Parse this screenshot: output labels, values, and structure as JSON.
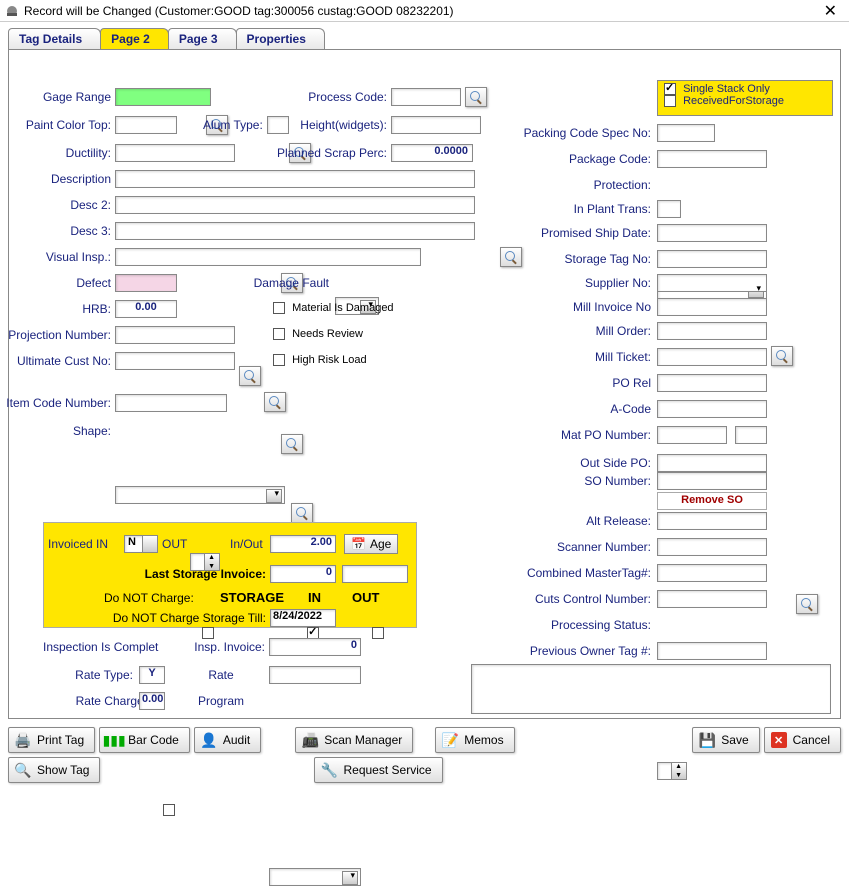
{
  "window": {
    "title": "Record will be Changed  (Customer:GOOD   tag:300056 custag:GOOD 08232201)",
    "close": "✕"
  },
  "tabs": {
    "t1": "Tag Details",
    "t2": "Page 2",
    "t3": "Page 3",
    "t4": "Properties"
  },
  "checks": {
    "single_stack": "Single Stack Only",
    "received_storage": "ReceivedForStorage",
    "material_damaged": "Material Is Damaged",
    "needs_review": "Needs Review",
    "high_risk": "High Risk Load",
    "storage": "STORAGE",
    "in": "IN",
    "out": "OUT"
  },
  "labels": {
    "gage_range": "Gage Range",
    "process_code": "Process Code:",
    "paint_color_top": "Paint Color Top:",
    "alum_type": "Alum Type:",
    "height_widgets": "Height(widgets):",
    "ductility": "Ductility:",
    "planned_scrap": "Planned Scrap Perc:",
    "description": "Description",
    "desc2": "Desc 2:",
    "desc3": "Desc 3:",
    "visual_insp": "Visual Insp.:",
    "defect": "Defect",
    "damage_fault": "Damage Fault",
    "hrb": "HRB:",
    "projection_number": "Projection Number:",
    "ultimate_cust": "Ultimate Cust No:",
    "item_code": "Item Code Number:",
    "shape": "Shape:",
    "packing_code": "Packing Code Spec No:",
    "package_code": "Package Code:",
    "protection": "Protection:",
    "in_plant": "In Plant Trans:",
    "promised_ship": "Promised Ship Date:",
    "storage_tag": "Storage Tag No:",
    "supplier_no": "Supplier No:",
    "mill_invoice": "Mill Invoice No",
    "mill_order": "Mill Order:",
    "mill_ticket": "Mill Ticket:",
    "po_rel": "PO Rel",
    "a_code": "A-Code",
    "mat_po": "Mat PO Number:",
    "outside_po": "Out Side PO:",
    "so_number": "SO Number:",
    "remove_so": "Remove SO",
    "alt_release": "Alt Release:",
    "scanner_number": "Scanner Number:",
    "combined_master": "Combined MasterTag#:",
    "cuts_control": "Cuts Control Number:",
    "processing_status": "Processing Status:",
    "prev_owner": "Previous Owner Tag #:",
    "invoiced_in": "Invoiced  IN",
    "out_label": "OUT",
    "in_out": "In/Out",
    "age": "Age",
    "last_storage": "Last Storage Invoice:",
    "do_not_charge": "Do NOT Charge:",
    "do_not_charge_till": "Do NOT Charge Storage Till:",
    "inspection_complete": "Inspection Is Complet",
    "insp_invoice": "Insp. Invoice:",
    "rate_type": "Rate Type:",
    "rate": "Rate",
    "rate_charge": "Rate Charge:",
    "program": "Program"
  },
  "values": {
    "planned_scrap": "0.0000",
    "hrb": "0.00",
    "in_out": "2.00",
    "last_storage": "0",
    "storage_till": "8/24/2022",
    "insp_invoice": "0",
    "rate_type": "Y",
    "rate_charge": "0.00",
    "invoiced_in": "N"
  },
  "buttons": {
    "print_tag": "Print Tag",
    "bar_code": "Bar Code",
    "audit": "Audit",
    "scan_manager": "Scan Manager",
    "memos": "Memos",
    "save": "Save",
    "cancel": "Cancel",
    "show_tag": "Show Tag",
    "request_service": "Request Service"
  }
}
